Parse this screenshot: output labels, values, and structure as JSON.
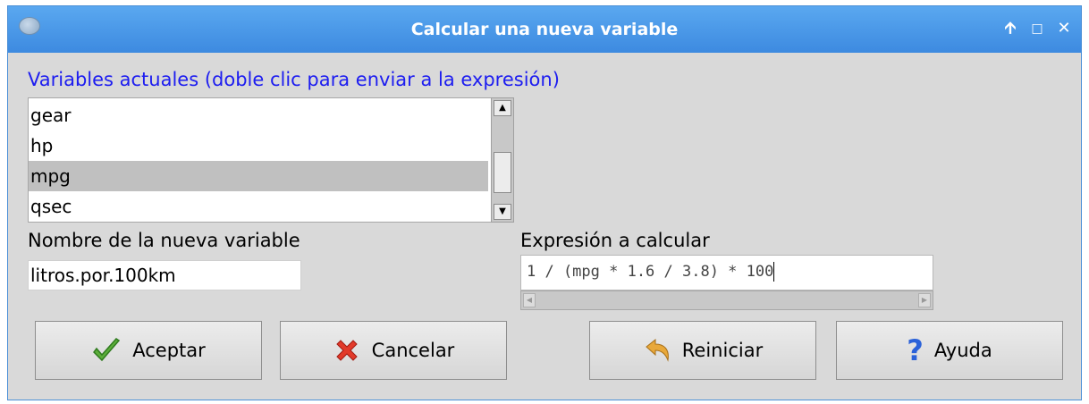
{
  "window": {
    "title": "Calcular una nueva variable",
    "controls": {
      "shade": "🡩",
      "maximize": "□",
      "close": "✕"
    }
  },
  "variables": {
    "label": "Variables actuales (doble clic para enviar a la expresión)",
    "items": [
      {
        "label": "gear",
        "selected": false
      },
      {
        "label": "hp",
        "selected": false
      },
      {
        "label": "mpg",
        "selected": true
      },
      {
        "label": "qsec",
        "selected": false
      }
    ]
  },
  "new_variable": {
    "label": "Nombre de la nueva variable",
    "value": "litros.por.100km"
  },
  "expression": {
    "label": "Expresión a calcular",
    "value": "1 / (mpg * 1.6 / 3.8) * 100"
  },
  "buttons": {
    "ok": "Aceptar",
    "cancel": "Cancelar",
    "reset": "Reiniciar",
    "help": "Ayuda"
  },
  "icons": {
    "ok": "check-icon",
    "cancel": "red-x-icon",
    "reset": "undo-arrow-icon",
    "help": "question-mark-icon"
  },
  "colors": {
    "titlebar": "#3d8ae0",
    "label_blue": "#1d1df0",
    "selection": "#c0c0c0"
  }
}
